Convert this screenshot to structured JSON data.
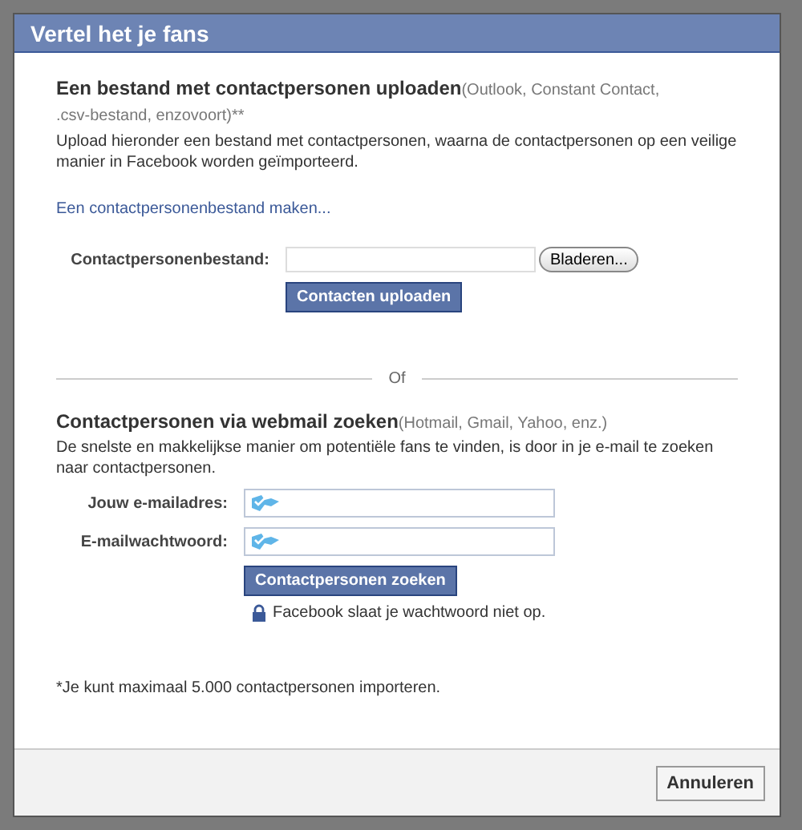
{
  "dialog": {
    "title": "Vertel het je fans"
  },
  "upload_section": {
    "heading": "**Een bestand met contactpersonen uploaden**(Outlook, Constant Contact, .csv-bestand, enzovoort)**",
    "description": "Upload hieronder een bestand met contactpersonen, waarna de contactpersonen op een veilige manier in Facebook worden geïmporteerd.",
    "link": "Een contactpersonenbestand maken...",
    "file_label": "Contactpersonenbestand:",
    "browse_button": "Bladeren...",
    "upload_button": "Contacten uploaden"
  },
  "divider": "Of",
  "webmail_section": {
    "heading": "**Contactpersonen via webmail zoeken**(Hotmail, Gmail, Yahoo, enz.)",
    "description": "De snelste en makkelijkse manier om potentiële fans te vinden, is door in je e-mail te zoeken naar contactpersonen.",
    "fields": [
      {
        "label": "Jouw e-mailadres:"
      },
      {
        "label": "E-mailwachtwoord:"
      }
    ],
    "search_button": "Contactpersonen zoeken",
    "privacy_note": "Facebook slaat je wachtwoord niet op."
  },
  "footnote": "*Je kunt maximaal 5.000 contactpersonen importeren.",
  "buttons": [
    "Annuleren"
  ]
}
